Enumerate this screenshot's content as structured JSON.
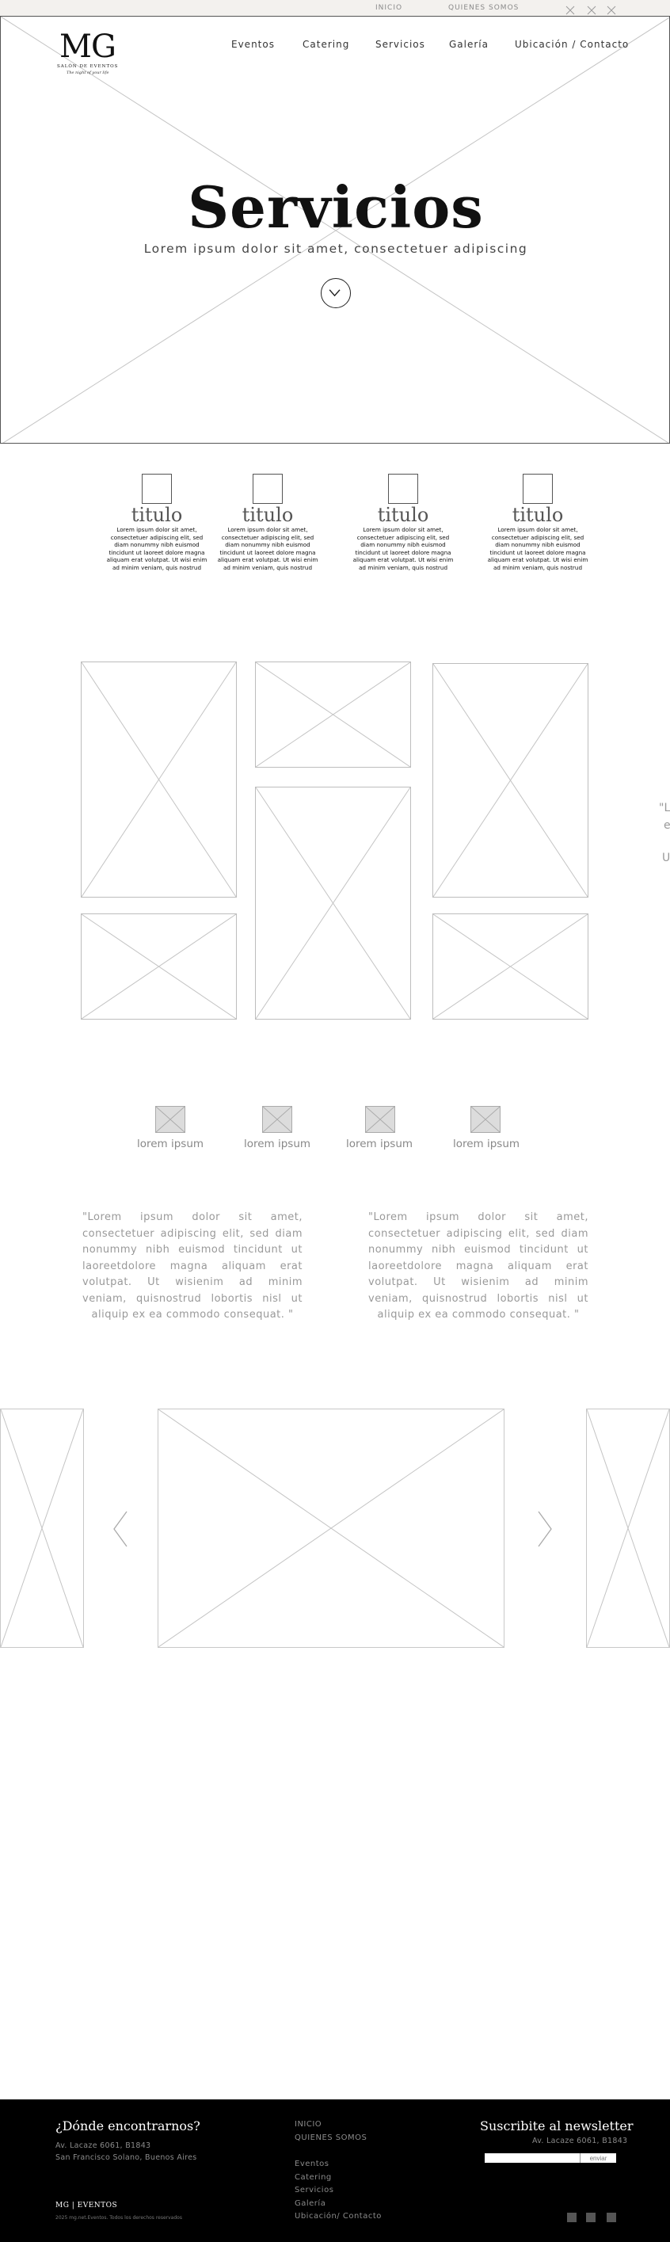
{
  "topbar": {
    "links": [
      "INICIO",
      "QUIENES SOMOS"
    ],
    "icons": [
      "close-icon",
      "close-icon",
      "close-icon"
    ]
  },
  "header": {
    "logo": {
      "mark": "MG",
      "subtitle": "SALÓN DE EVENTOS",
      "tagline": "The night of your life"
    },
    "nav": [
      "Eventos",
      "Catering",
      "Servicios",
      "Galería",
      "Ubicación / Contacto"
    ]
  },
  "hero": {
    "title": "Servicios",
    "subtitle": "Lorem ipsum dolor sit amet, consectetuer adipiscing",
    "scroll_icon": "chevron-down-icon"
  },
  "features": [
    {
      "title": "titulo",
      "text": "Lorem ipsum dolor sit amet, consectetuer adipiscing elit, sed diam nonummy nibh euismod tincidunt ut laoreet dolore magna aliquam erat volutpat. Ut wisi enim ad minim veniam, quis nostrud"
    },
    {
      "title": "titulo",
      "text": "Lorem ipsum dolor sit amet, consectetuer adipiscing elit, sed diam nonummy nibh euismod tincidunt ut laoreet dolore magna aliquam erat volutpat. Ut wisi enim ad minim veniam, quis nostrud"
    },
    {
      "title": "titulo",
      "text": "Lorem ipsum dolor sit amet, consectetuer adipiscing elit, sed diam nonummy nibh euismod tincidunt ut laoreet dolore magna aliquam erat volutpat. Ut wisi enim ad minim veniam, quis nostrud"
    },
    {
      "title": "titulo",
      "text": "Lorem ipsum dolor sit amet, consectetuer adipiscing elit, sed diam nonummy nibh euismod tincidunt ut laoreet dolore magna aliquam erat volutpat. Ut wisi enim ad minim veniam, quis nostrud"
    }
  ],
  "side_quote": {
    "lines": [
      "\"Lo",
      "e",
      "U"
    ]
  },
  "icon_row": [
    {
      "label": "lorem ipsum"
    },
    {
      "label": "lorem ipsum"
    },
    {
      "label": "lorem ipsum"
    },
    {
      "label": "lorem ipsum"
    }
  ],
  "quotes": [
    {
      "text": "\"Lorem ipsum dolor sit amet, consectetuer adipiscing elit, sed diam nonummy nibh euismod tincidunt ut laoreetdolore magna aliquam erat volutpat. Ut wisienim ad minim veniam, quisnostrud lobortis nisl ut aliquip ex ea commodo consequat. \""
    },
    {
      "text": "\"Lorem ipsum dolor sit amet, consectetuer adipiscing elit, sed diam nonummy nibh euismod tincidunt ut laoreetdolore magna aliquam erat volutpat. Ut wisienim ad minim veniam, quisnostrud lobortis nisl ut aliquip ex ea commodo consequat. \""
    }
  ],
  "carousel": {
    "prev_icon": "chevron-left-icon",
    "next_icon": "chevron-right-icon"
  },
  "footer": {
    "location_title": "¿Dónde encontrarnos?",
    "address_1": "Av. Lacaze 6061, B1843",
    "address_2": "San Francisco Solano, Buenos Aires",
    "links_top": [
      "INICIO",
      "QUIENES SOMOS"
    ],
    "links": [
      "Eventos",
      "Catering",
      "Servicios",
      "Galería",
      "Ubicación/ Contacto"
    ],
    "newsletter_title": "Suscribite al newsletter",
    "newsletter_address": "Av. Lacaze 6061, B1843",
    "newsletter_button": "enviar",
    "logo": "MG | EVENTOS",
    "copyright": "2025 mg.net.Eventos. Todos los derechos reservados",
    "social_icons": [
      "social-icon",
      "social-icon",
      "social-icon"
    ]
  }
}
